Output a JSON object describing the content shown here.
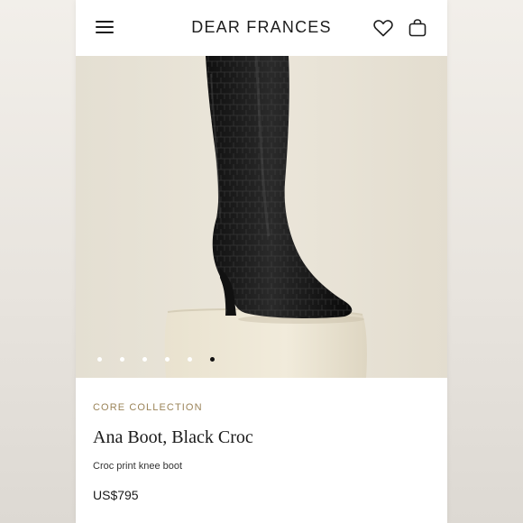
{
  "header": {
    "brand": "DEAR FRANCES",
    "icons": [
      "menu-icon",
      "heart-icon",
      "shopping-bag-icon"
    ]
  },
  "gallery": {
    "image_count": 6,
    "active_index": 5
  },
  "product": {
    "collection": "CORE COLLECTION",
    "name": "Ana Boot, Black Croc",
    "description": "Croc print knee boot",
    "price": "US$795"
  },
  "colors": {
    "accent": "#9b8459",
    "text": "#1a1a1a",
    "background": "#ffffff"
  }
}
